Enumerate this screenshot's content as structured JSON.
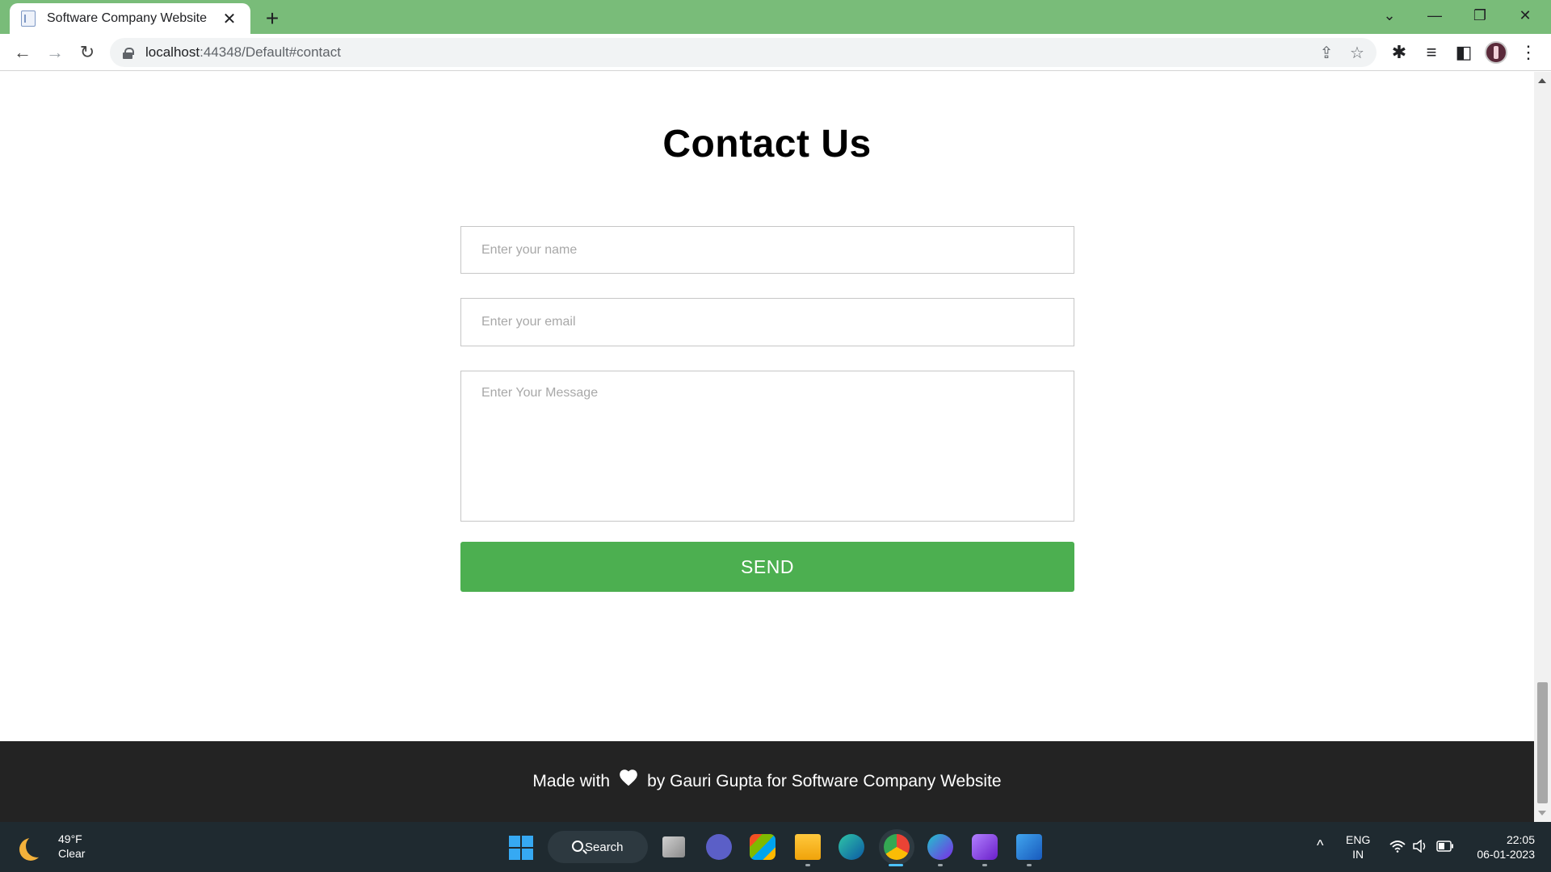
{
  "browser": {
    "tab_title": "Software Company Website",
    "tab_close": "✕",
    "new_tab": "+",
    "url_host": "localhost",
    "url_rest": ":44348/Default#contact",
    "nav_back": "←",
    "nav_forward": "→",
    "nav_reload": "↻",
    "win_dropdown": "⌄",
    "win_minimize": "—",
    "win_restore": "❐",
    "win_close": "✕",
    "share_icon": "⇪",
    "star_icon": "☆",
    "extensions_icon": "✱",
    "media_icon": "≡",
    "sidepanel_icon": "◧",
    "menu_icon": "⋮"
  },
  "contact": {
    "title": "Contact Us",
    "name_placeholder": "Enter your name",
    "email_placeholder": "Enter your email",
    "message_placeholder": "Enter Your Message",
    "send_label": "SEND"
  },
  "footer": {
    "text_before": "Made with",
    "text_after": "by Gauri Gupta for Software Company Website"
  },
  "taskbar": {
    "weather_temp": "49°F",
    "weather_desc": "Clear",
    "search_label": "Search",
    "apps": [
      "task-view",
      "teams-chat",
      "microsoft-store",
      "file-explorer",
      "edge",
      "chrome",
      "canva",
      "visual-studio",
      "word"
    ],
    "chevron": "^",
    "lang_1": "ENG",
    "lang_2": "IN",
    "time": "22:05",
    "date": "06-01-2023"
  },
  "colors": {
    "tabstrip": "#79bc79",
    "send_button": "#4caf50",
    "footer_bg": "#232323",
    "taskbar_bg": "#1f2a30"
  }
}
